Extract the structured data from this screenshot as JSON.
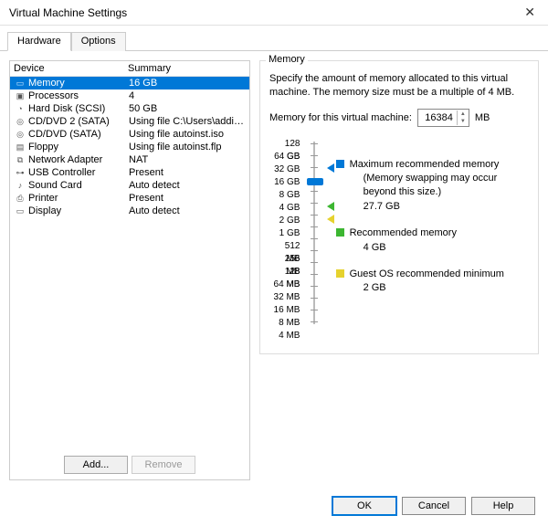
{
  "window": {
    "title": "Virtual Machine Settings"
  },
  "tabs": {
    "hardware": "Hardware",
    "options": "Options"
  },
  "devicelist": {
    "hdr_device": "Device",
    "hdr_summary": "Summary",
    "items": [
      {
        "icon": "▭",
        "name": "Memory",
        "summary": "16 GB",
        "selected": true
      },
      {
        "icon": "▣",
        "name": "Processors",
        "summary": "4"
      },
      {
        "icon": "◔",
        "name": "Hard Disk (SCSI)",
        "summary": "50 GB"
      },
      {
        "icon": "◎",
        "name": "CD/DVD 2 (SATA)",
        "summary": "Using file C:\\Users\\addis\\Drop..."
      },
      {
        "icon": "◎",
        "name": "CD/DVD (SATA)",
        "summary": "Using file autoinst.iso"
      },
      {
        "icon": "▤",
        "name": "Floppy",
        "summary": "Using file autoinst.flp"
      },
      {
        "icon": "⧉",
        "name": "Network Adapter",
        "summary": "NAT"
      },
      {
        "icon": "⊶",
        "name": "USB Controller",
        "summary": "Present"
      },
      {
        "icon": "♪",
        "name": "Sound Card",
        "summary": "Auto detect"
      },
      {
        "icon": "⎙",
        "name": "Printer",
        "summary": "Present"
      },
      {
        "icon": "▭",
        "name": "Display",
        "summary": "Auto detect"
      }
    ]
  },
  "buttons": {
    "add": "Add...",
    "remove": "Remove",
    "ok": "OK",
    "cancel": "Cancel",
    "help": "Help"
  },
  "memory": {
    "group_title": "Memory",
    "description": "Specify the amount of memory allocated to this virtual machine. The memory size must be a multiple of 4 MB.",
    "label": "Memory for this virtual machine:",
    "value": "16384",
    "unit": "MB",
    "scale": [
      "128 GB",
      "64 GB",
      "32 GB",
      "16 GB",
      "8 GB",
      "4 GB",
      "2 GB",
      "1 GB",
      "512 MB",
      "256 MB",
      "128 MB",
      "64 MB",
      "32 MB",
      "16 MB",
      "8 MB",
      "4 MB"
    ],
    "legend": {
      "max_label": "Maximum recommended memory",
      "max_note": "(Memory swapping may occur beyond this size.)",
      "max_value": "27.7 GB",
      "rec_label": "Recommended memory",
      "rec_value": "4 GB",
      "min_label": "Guest OS recommended minimum",
      "min_value": "2 GB"
    }
  },
  "chart_data": {
    "type": "bar",
    "orientation": "vertical-slider",
    "unit": "MB",
    "scale_labels": [
      "128 GB",
      "64 GB",
      "32 GB",
      "16 GB",
      "8 GB",
      "4 GB",
      "2 GB",
      "1 GB",
      "512 MB",
      "256 MB",
      "128 MB",
      "64 MB",
      "32 MB",
      "16 MB",
      "8 MB",
      "4 MB"
    ],
    "current_value_mb": 16384,
    "markers": [
      {
        "name": "Maximum recommended memory",
        "value_label": "27.7 GB",
        "color": "#0078d7"
      },
      {
        "name": "Recommended memory",
        "value_label": "4 GB",
        "color": "#3cb631"
      },
      {
        "name": "Guest OS recommended minimum",
        "value_label": "2 GB",
        "color": "#e6d22e"
      }
    ]
  }
}
